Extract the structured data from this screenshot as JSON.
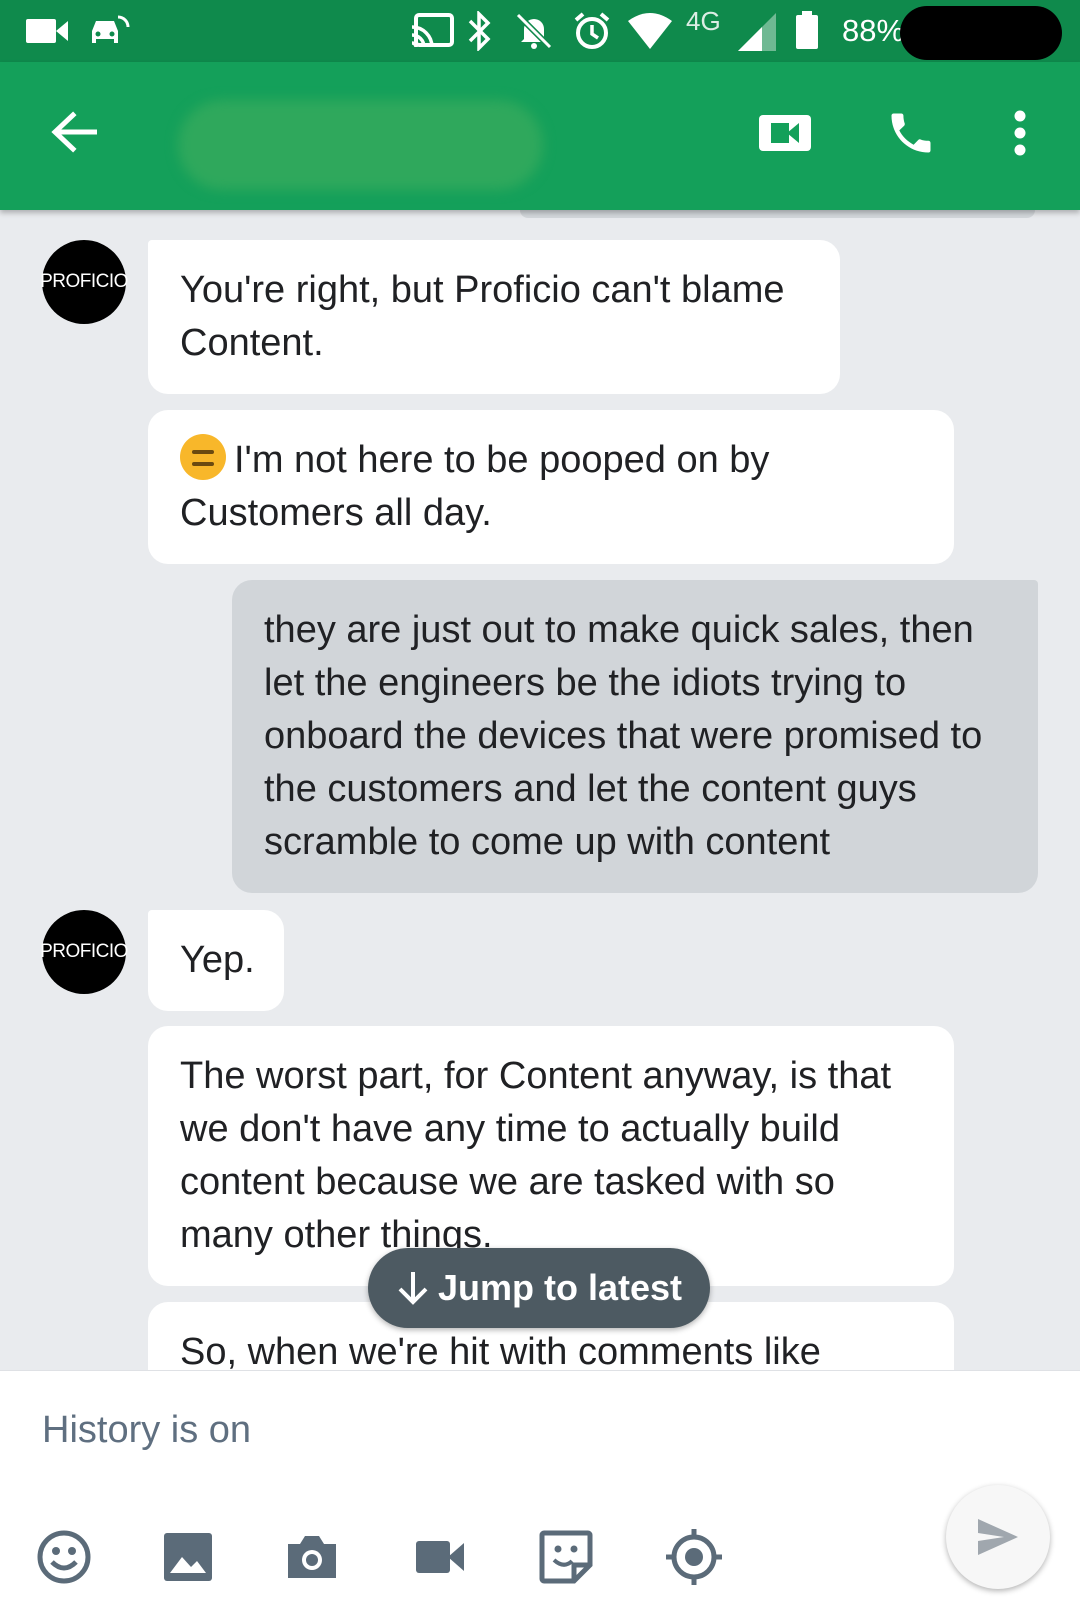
{
  "status_bar": {
    "network": "4G",
    "battery": "88%"
  },
  "header": {
    "icons": [
      "back-arrow-icon",
      "video-call-icon",
      "phone-call-icon",
      "more-vert-icon"
    ]
  },
  "messages": [
    {
      "sender": "PROFICIO",
      "direction": "in",
      "text": "You're right, but Proficio can't blame Content."
    },
    {
      "sender": "PROFICIO",
      "direction": "in",
      "emoji": "expressionless-face-icon",
      "text": "I'm not here to be pooped on by Customers all day."
    },
    {
      "direction": "out",
      "text": "they are just out to make quick sales, then let the engineers be the idiots trying to onboard the devices that were promised to the customers and let the content guys scramble to come up with content"
    },
    {
      "sender": "PROFICIO",
      "direction": "in",
      "text": "Yep."
    },
    {
      "sender": "PROFICIO",
      "direction": "in",
      "text": "The worst part, for Content anyway, is that we don't have any time to actually build content because we are tasked with so many other things."
    },
    {
      "sender": "PROFICIO",
      "direction": "in",
      "text": "So, when we're hit with comments like"
    }
  ],
  "jump_button": {
    "label": "Jump to latest"
  },
  "compose": {
    "placeholder": "History is on",
    "tools": [
      "emoji-icon",
      "image-icon",
      "camera-icon",
      "video-icon",
      "sticker-icon",
      "location-icon"
    ],
    "send_icon": "send-icon"
  },
  "colors": {
    "status_bar": "#0f8a4c",
    "app_bar": "#14a05a",
    "chat_background": "#e9ebee",
    "incoming_bubble": "#ffffff",
    "outgoing_bubble": "#d1d5d9",
    "jump_button": "#4d5a62",
    "tool_icons": "#5b6b79"
  }
}
